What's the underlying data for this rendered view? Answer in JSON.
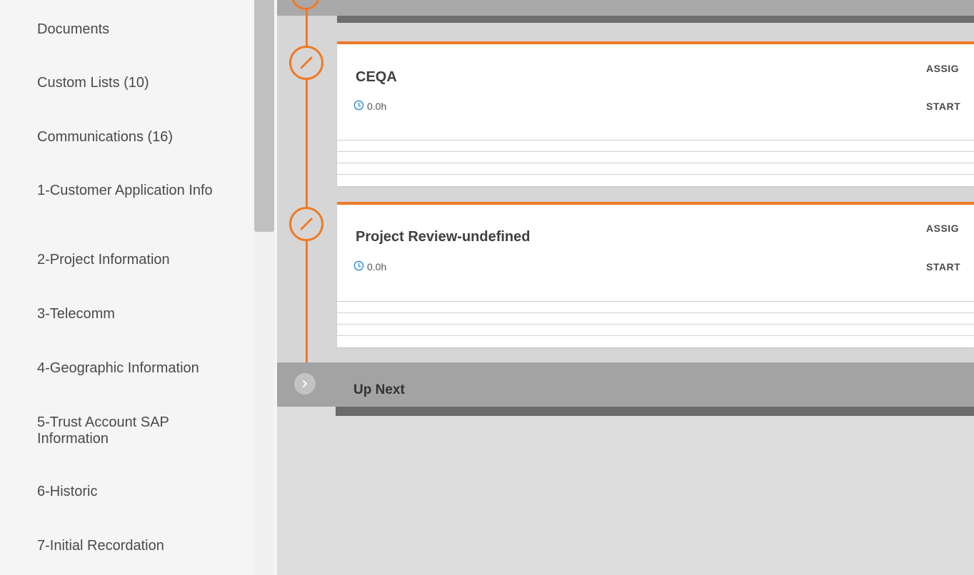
{
  "sidebar": {
    "items": [
      {
        "label": "Documents"
      },
      {
        "label": "Custom Lists (10)"
      },
      {
        "label": "Communications (16)"
      },
      {
        "label": "1-Customer Application Info"
      },
      {
        "label": "2-Project Information"
      },
      {
        "label": "3-Telecomm"
      },
      {
        "label": "4-Geographic Information"
      },
      {
        "label": "5-Trust Account SAP Information"
      },
      {
        "label": "6-Historic"
      },
      {
        "label": "7-Initial Recordation"
      }
    ]
  },
  "timeline": {
    "tasks": [
      {
        "title": "CEQA",
        "hours": "0.0h",
        "assigned_label": "ASSIG",
        "start_label": "START"
      },
      {
        "title": "Project Review-undefined",
        "hours": "0.0h",
        "assigned_label": "ASSIG",
        "start_label": "START"
      }
    ],
    "up_next": {
      "label": "Up Next"
    }
  },
  "colors": {
    "accent": "#f07a24",
    "clock_icon": "#3a8fd6"
  },
  "icons": {
    "task_node": "pencil-icon",
    "time": "clock-icon",
    "expand": "chevron-right-icon"
  }
}
